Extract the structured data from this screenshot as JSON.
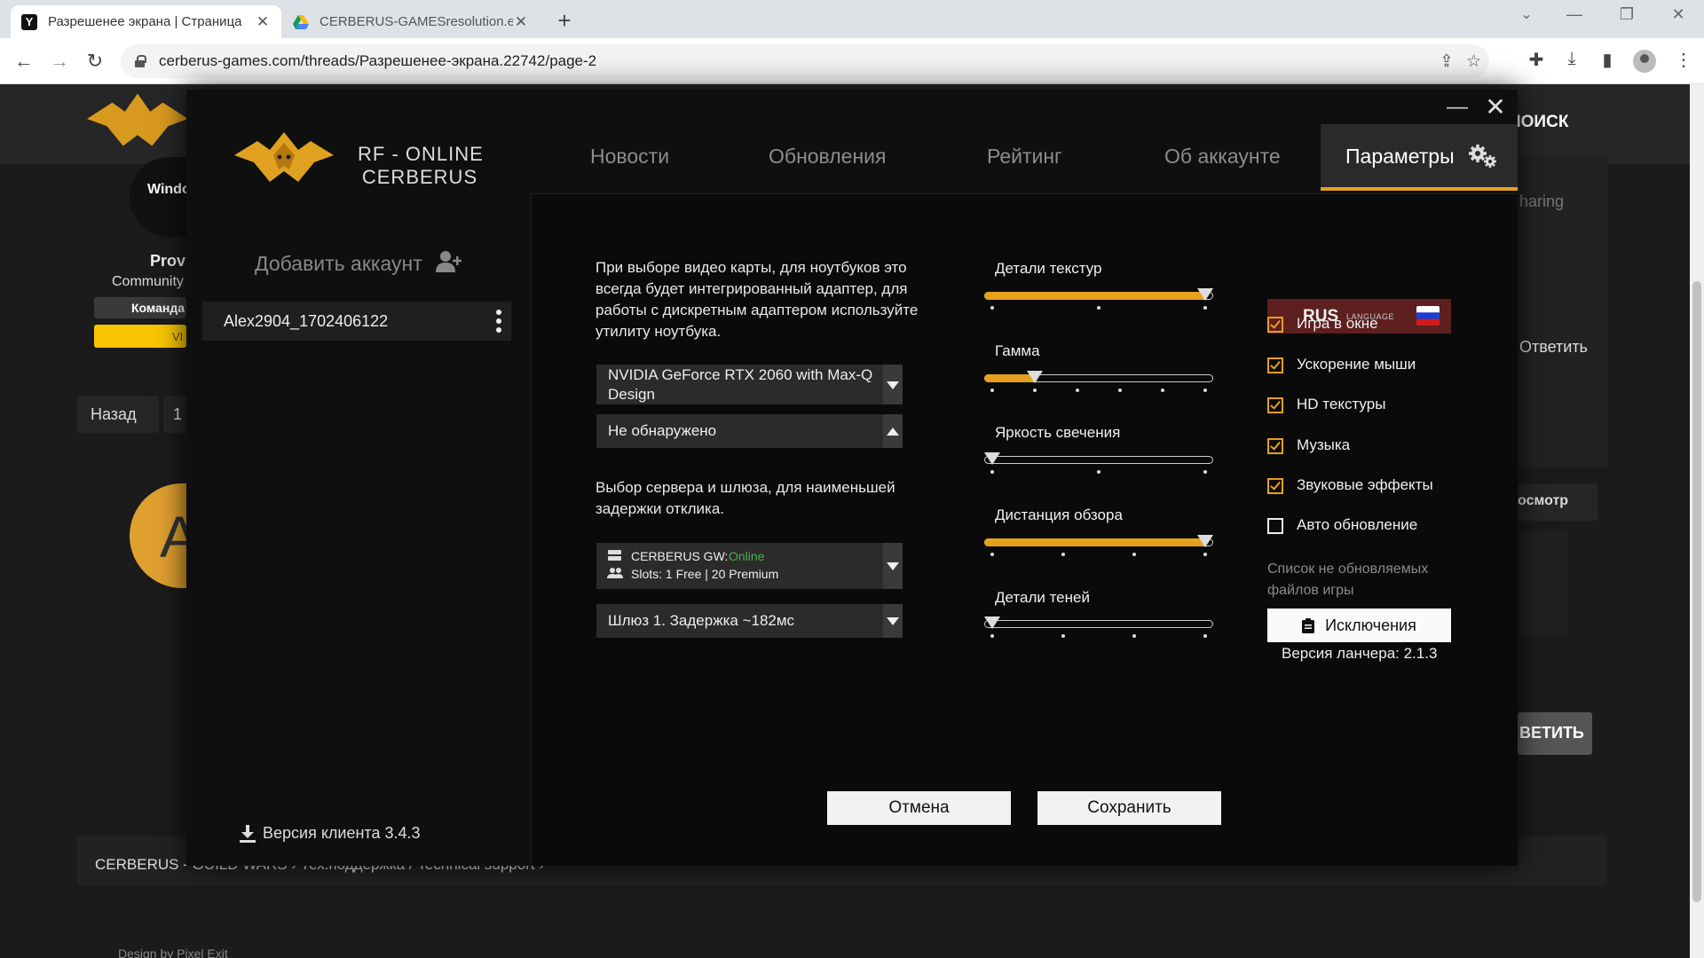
{
  "browser": {
    "tabs": [
      {
        "title": "Разрешенее экрана | Страница",
        "close": "✕"
      },
      {
        "title": "CERBERUS-GAMESresolution.exe",
        "close": "✕"
      }
    ],
    "new_tab": "+",
    "window_controls": [
      "⌄",
      "—",
      "❐",
      "✕"
    ],
    "nav": {
      "back": "←",
      "forward": "→",
      "reload": "↻"
    },
    "url": "cerberus-games.com/threads/Разрешенее-экрана.22742/page-2",
    "omni_icons": {
      "share": "⇪",
      "star": "☆"
    },
    "extensions": {
      "puzzle": "✚",
      "download": "⤓",
      "sidepanel": "▮",
      "menu": "⋮"
    }
  },
  "page_behind": {
    "search": "ПОИСК",
    "sharing": "haring",
    "reply_link": "Ответить",
    "windows_label": "Windo",
    "user_name": "Prov",
    "user_title": "Community",
    "team_badge": "Команда",
    "vip_badge": "VI",
    "back_button": "Назад",
    "page_one": "1",
    "avatar_letter": "A",
    "preview": "осмотр",
    "reply_button": "ВЕТИТЬ",
    "breadcrumb": "CERBERUS - GUILD WARS  ›  Тех.поддержка / Technical support  ›",
    "footer": "Design by Pixel Exit"
  },
  "launcher": {
    "brand": "RF - ONLINE\nCERBERUS",
    "window": {
      "minimize": "—",
      "close": "✕"
    },
    "nav": [
      "Новости",
      "Обновления",
      "Рейтинг",
      "Об аккаунте",
      "Параметры"
    ],
    "add_account": "Добавить аккаунт",
    "accounts": [
      {
        "name": "Alex2904_1702406122"
      }
    ],
    "client_version": "Версия клиента 3.4.3",
    "gpu_note": "При выборе видео карты, для ноутбуков это всегда будет интегрированный адаптер, для работы с дискретным адаптером используйте утилиту ноутбука.",
    "gpu_select": "NVIDIA GeForce RTX 2060 with Max-Q Design",
    "gpu_select2": "Не обнаружено",
    "server_note": "Выбор сервера и шлюза, для наименьшей задержки отклика.",
    "server": {
      "name": "CERBERUS GW:",
      "status": "Online",
      "slots": "Slots: 1 Free | 20 Premium"
    },
    "gateway": "Шлюз 1. Задержка ~182мс",
    "sliders": [
      {
        "label": "Детали текстур",
        "value": 1.0,
        "steps": 3
      },
      {
        "label": "Гамма",
        "value": 0.2,
        "steps": 6
      },
      {
        "label": "Яркость свечения",
        "value": 0.0,
        "steps": 3
      },
      {
        "label": "Дистанция обзора",
        "value": 1.0,
        "steps": 4
      },
      {
        "label": "Детали теней",
        "value": 0.0,
        "steps": 4
      }
    ],
    "language": {
      "code": "RUS",
      "label": "LANGUAGE"
    },
    "options": [
      {
        "label": "Игра в окне",
        "checked": true
      },
      {
        "label": "Ускорение мыши",
        "checked": true
      },
      {
        "label": "HD текстуры",
        "checked": true
      },
      {
        "label": "Музыка",
        "checked": true
      },
      {
        "label": "Звуковые эффекты",
        "checked": true
      },
      {
        "label": "Авто обновление",
        "checked": false
      }
    ],
    "exclusions_note": "Список не обновляемых файлов игры",
    "exclusions_button": "Исключения",
    "launcher_version": "Версия ланчера: 2.1.3",
    "cancel": "Отмена",
    "save": "Сохранить",
    "colors": {
      "accent": "#e6a11c",
      "panel": "#0f0f0f",
      "online": "#4caf50"
    }
  }
}
